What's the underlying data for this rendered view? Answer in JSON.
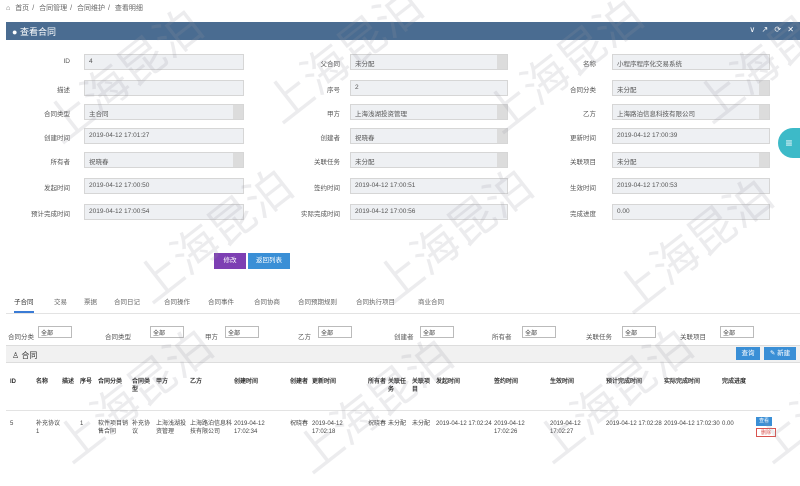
{
  "breadcrumb": [
    "首页",
    "合同管理",
    "合同维护",
    "查看明细"
  ],
  "panel_title": "查看合同",
  "panel_tools": "∨ ↗ ⟳ ✕",
  "form": {
    "id_label": "ID",
    "id_value": "4",
    "parent_label": "父合同",
    "parent_value": "未分配",
    "name_label": "名称",
    "name_value": "小程序程序化交易系统",
    "desc_label": "描述",
    "desc_value": "",
    "seq_label": "序号",
    "seq_value": "2",
    "category_label": "合同分类",
    "category_value": "未分配",
    "type_label": "合同类型",
    "type_value": "主合同",
    "party_a_label": "甲方",
    "party_a_value": "上海浅湖投资管理",
    "party_b_label": "乙方",
    "party_b_value": "上海路泊信息科技有限公司",
    "created_label": "创建时间",
    "created_value": "2019-04-12 17:01:27",
    "creator_label": "创建者",
    "creator_value": "祝晓春",
    "updated_label": "更新时间",
    "updated_value": "2019-04-12 17:00:39",
    "owner_label": "所有者",
    "owner_value": "祝晓春",
    "task_label": "关联任务",
    "task_value": "未分配",
    "project_label": "关联项目",
    "project_value": "未分配",
    "start_label": "发起时间",
    "start_value": "2019-04-12 17:00:50",
    "sign_label": "签约时间",
    "sign_value": "2019-04-12 17:00:51",
    "effective_label": "生效时间",
    "effective_value": "2019-04-12 17:00:53",
    "est_done_label": "预计完成时间",
    "est_done_value": "2019-04-12 17:00:54",
    "actual_done_label": "实际完成时间",
    "actual_done_value": "2019-04-12 17:00:56",
    "progress_label": "完成进度",
    "progress_value": "0.00"
  },
  "buttons": {
    "edit": "修改",
    "back": "返回列表"
  },
  "tabs": [
    "子合同",
    "交易",
    "票据",
    "合同日记",
    "合同操作",
    "合同事件",
    "合同协商",
    "合同预期规则",
    "合同执行项目",
    "商业合同"
  ],
  "filters": [
    {
      "label": "合同分类",
      "value": "全部"
    },
    {
      "label": "合同类型",
      "value": "全部"
    },
    {
      "label": "甲方",
      "value": "全部"
    },
    {
      "label": "乙方",
      "value": "全部"
    },
    {
      "label": "创建者",
      "value": "全部"
    },
    {
      "label": "所有者",
      "value": "全部"
    },
    {
      "label": "关联任务",
      "value": "全部"
    },
    {
      "label": "关联项目",
      "value": "全部"
    }
  ],
  "section_title": "合同",
  "section_buttons": {
    "query": "查询",
    "create": "✎ 新建"
  },
  "table": {
    "headers": [
      "ID",
      "名称",
      "描述",
      "序号",
      "合同分类",
      "合同类型",
      "甲方",
      "乙方",
      "创建时间",
      "创建者",
      "更新时间",
      "所有者",
      "关联任务",
      "关联项目",
      "发起时间",
      "签约时间",
      "生效时间",
      "预计完成时间",
      "实际完成时间",
      "完成进度"
    ],
    "row": [
      "5",
      "补充协议1",
      "",
      "1",
      "软件项目销售合同",
      "补充协议",
      "上海浅湖投资管理",
      "上海路泊信息科技有限公司",
      "2019-04-12 17:02:34",
      "祝晓春",
      "2019-04-12 17:02:18",
      "祝晓春",
      "未分配",
      "未分配",
      "2019-04-12 17:02:24",
      "2019-04-12 17:02:26",
      "2019-04-12 17:02:27",
      "2019-04-12 17:02:28",
      "2019-04-12 17:02:30",
      "0.00"
    ],
    "row_actions": {
      "view": "查看",
      "delete": "删除"
    }
  },
  "watermark": "上海昆泊",
  "colors": {
    "header": "#4a6c91",
    "edit": "#7d3fb3",
    "back": "#3a8fd6",
    "fab": "#3dbac8"
  }
}
